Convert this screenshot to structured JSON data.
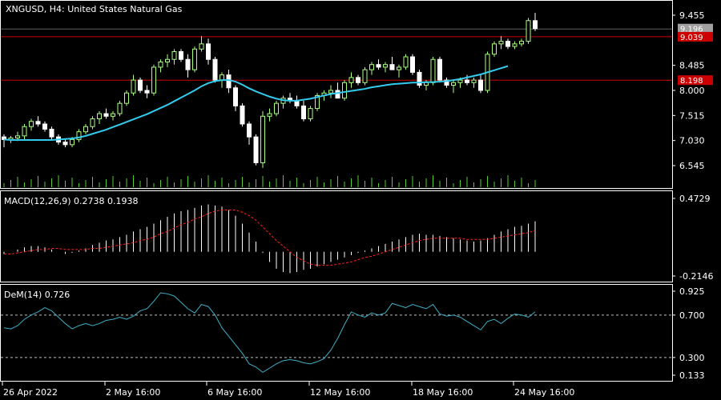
{
  "colors": {
    "background": "#000000",
    "frame": "#ffffff",
    "bull_candle": "#aaff7f",
    "bear_candle": "#ffffff",
    "volume": "#55cc33",
    "ma_line": "#33ccee",
    "hline": "#cc0000",
    "price_tag": "#a0a0a0",
    "macd_hist": "#ffffff",
    "macd_signal": "#ff2020",
    "dem_line": "#3fb0c8",
    "dem_level": "#c0c0c0"
  },
  "header": {
    "symbol_label": "XNGUSD, H4:  United States Natural Gas"
  },
  "x_axis": {
    "labels": [
      "26 Apr 2022",
      "2 May 16:00",
      "6 May 16:00",
      "12 May 16:00",
      "18 May 16:00",
      "24 May 16:00"
    ]
  },
  "chart_data": [
    {
      "type": "candlestick",
      "title": "XNGUSD, H4:  United States Natural Gas",
      "y_ticks": [
        "9.455",
        "8.485",
        "8.000",
        "7.515",
        "7.030",
        "6.545"
      ],
      "ylim": [
        6.2,
        9.55
      ],
      "price_tags": [
        {
          "text": "9.196",
          "value": 9.196,
          "kind": "current"
        },
        {
          "text": "9.039",
          "value": 9.039,
          "kind": "level"
        },
        {
          "text": "8.198",
          "value": 8.198,
          "kind": "level"
        }
      ],
      "horizontal_lines": [
        9.039,
        8.198
      ],
      "candles": [
        [
          7.1,
          7.15,
          6.9,
          7.05
        ],
        [
          7.05,
          7.12,
          6.98,
          7.08
        ],
        [
          7.08,
          7.2,
          7.02,
          7.12
        ],
        [
          7.12,
          7.35,
          7.05,
          7.3
        ],
        [
          7.3,
          7.45,
          7.22,
          7.4
        ],
        [
          7.4,
          7.5,
          7.3,
          7.35
        ],
        [
          7.35,
          7.4,
          7.2,
          7.25
        ],
        [
          7.25,
          7.3,
          7.05,
          7.1
        ],
        [
          7.1,
          7.15,
          6.95,
          7.0
        ],
        [
          7.0,
          7.05,
          6.9,
          6.95
        ],
        [
          6.95,
          7.1,
          6.9,
          7.05
        ],
        [
          7.05,
          7.25,
          7.0,
          7.2
        ],
        [
          7.2,
          7.35,
          7.15,
          7.3
        ],
        [
          7.3,
          7.5,
          7.25,
          7.45
        ],
        [
          7.45,
          7.6,
          7.35,
          7.55
        ],
        [
          7.55,
          7.65,
          7.45,
          7.5
        ],
        [
          7.5,
          7.6,
          7.42,
          7.55
        ],
        [
          7.55,
          7.8,
          7.5,
          7.75
        ],
        [
          7.75,
          8.0,
          7.7,
          7.95
        ],
        [
          7.95,
          8.3,
          7.9,
          8.2
        ],
        [
          8.2,
          8.25,
          7.95,
          8.0
        ],
        [
          8.0,
          8.1,
          7.85,
          7.95
        ],
        [
          7.95,
          8.5,
          7.9,
          8.45
        ],
        [
          8.45,
          8.6,
          8.35,
          8.55
        ],
        [
          8.55,
          8.7,
          8.45,
          8.6
        ],
        [
          8.6,
          8.8,
          8.5,
          8.75
        ],
        [
          8.75,
          8.8,
          8.55,
          8.6
        ],
        [
          8.6,
          8.7,
          8.25,
          8.4
        ],
        [
          8.4,
          8.85,
          8.35,
          8.8
        ],
        [
          8.8,
          9.05,
          8.75,
          8.9
        ],
        [
          8.9,
          9.0,
          8.5,
          8.6
        ],
        [
          8.6,
          8.65,
          8.15,
          8.2
        ],
        [
          8.2,
          8.35,
          8.05,
          8.3
        ],
        [
          8.3,
          8.4,
          7.95,
          8.05
        ],
        [
          8.05,
          8.1,
          7.6,
          7.7
        ],
        [
          7.7,
          7.75,
          7.3,
          7.35
        ],
        [
          7.35,
          7.4,
          6.95,
          7.1
        ],
        [
          7.1,
          7.15,
          6.55,
          6.6
        ],
        [
          6.6,
          7.6,
          6.5,
          7.5
        ],
        [
          7.5,
          7.65,
          7.4,
          7.55
        ],
        [
          7.55,
          7.8,
          7.5,
          7.75
        ],
        [
          7.75,
          7.9,
          7.65,
          7.85
        ],
        [
          7.85,
          7.95,
          7.75,
          7.8
        ],
        [
          7.8,
          7.9,
          7.65,
          7.7
        ],
        [
          7.7,
          7.8,
          7.4,
          7.45
        ],
        [
          7.45,
          7.7,
          7.4,
          7.65
        ],
        [
          7.65,
          7.95,
          7.6,
          7.9
        ],
        [
          7.9,
          8.0,
          7.8,
          7.95
        ],
        [
          7.95,
          8.1,
          7.85,
          8.0
        ],
        [
          8.0,
          8.15,
          7.9,
          7.85
        ],
        [
          7.85,
          8.2,
          7.8,
          8.15
        ],
        [
          8.15,
          8.35,
          8.05,
          8.25
        ],
        [
          8.25,
          8.3,
          8.1,
          8.15
        ],
        [
          8.15,
          8.45,
          8.1,
          8.4
        ],
        [
          8.4,
          8.55,
          8.3,
          8.5
        ],
        [
          8.5,
          8.6,
          8.4,
          8.45
        ],
        [
          8.45,
          8.55,
          8.35,
          8.5
        ],
        [
          8.5,
          8.65,
          8.45,
          8.4
        ],
        [
          8.4,
          8.5,
          8.25,
          8.45
        ],
        [
          8.45,
          8.7,
          8.4,
          8.65
        ],
        [
          8.65,
          8.7,
          8.3,
          8.35
        ],
        [
          8.35,
          8.4,
          8.05,
          8.1
        ],
        [
          8.1,
          8.2,
          8.0,
          8.15
        ],
        [
          8.15,
          8.65,
          8.1,
          8.6
        ],
        [
          8.6,
          8.65,
          8.15,
          8.2
        ],
        [
          8.2,
          8.25,
          8.05,
          8.1
        ],
        [
          8.1,
          8.2,
          7.95,
          8.15
        ],
        [
          8.15,
          8.25,
          8.05,
          8.2
        ],
        [
          8.2,
          8.3,
          8.1,
          8.15
        ],
        [
          8.15,
          8.25,
          8.05,
          8.2
        ],
        [
          8.2,
          8.3,
          7.95,
          8.0
        ],
        [
          8.0,
          8.75,
          7.95,
          8.7
        ],
        [
          8.7,
          8.95,
          8.65,
          8.9
        ],
        [
          8.9,
          9.05,
          8.8,
          8.95
        ],
        [
          8.95,
          9.0,
          8.8,
          8.85
        ],
        [
          8.85,
          8.95,
          8.8,
          8.9
        ],
        [
          8.9,
          9.0,
          8.85,
          8.95
        ],
        [
          8.95,
          9.4,
          8.9,
          9.35
        ],
        [
          9.35,
          9.5,
          9.15,
          9.196
        ]
      ],
      "ma_line": [
        7.05,
        7.04,
        7.04,
        7.04,
        7.04,
        7.04,
        7.04,
        7.04,
        7.05,
        7.06,
        7.07,
        7.09,
        7.12,
        7.16,
        7.2,
        7.24,
        7.29,
        7.34,
        7.39,
        7.44,
        7.49,
        7.54,
        7.6,
        7.66,
        7.72,
        7.79,
        7.86,
        7.93,
        8.0,
        8.08,
        8.14,
        8.18,
        8.2,
        8.2,
        8.17,
        8.11,
        8.04,
        7.98,
        7.93,
        7.88,
        7.84,
        7.81,
        7.8,
        7.8,
        7.82,
        7.84,
        7.87,
        7.9,
        7.93,
        7.95,
        7.97,
        7.99,
        8.01,
        8.03,
        8.06,
        8.08,
        8.1,
        8.12,
        8.13,
        8.14,
        8.15,
        8.15,
        8.16,
        8.16,
        8.17,
        8.18,
        8.2,
        8.22,
        8.25,
        8.28,
        8.31,
        8.35,
        8.39,
        8.43,
        8.47
      ]
    },
    {
      "type": "bar",
      "title": "MACD(12,26,9) 0.2738 0.1938",
      "label": "MACD(12,26,9)",
      "macd_value": "0.2738",
      "signal_value": "0.1938",
      "y_ticks": [
        "0.4729",
        "-0.2146"
      ],
      "ylim": [
        -0.2146,
        0.4729
      ],
      "series": [
        {
          "name": "MACD",
          "type": "bar",
          "values": [
            -0.02,
            0.0,
            0.02,
            0.04,
            0.05,
            0.05,
            0.04,
            0.02,
            0.0,
            -0.02,
            -0.01,
            0.01,
            0.03,
            0.06,
            0.08,
            0.1,
            0.11,
            0.13,
            0.15,
            0.18,
            0.2,
            0.22,
            0.25,
            0.28,
            0.31,
            0.34,
            0.36,
            0.37,
            0.39,
            0.41,
            0.42,
            0.41,
            0.4,
            0.37,
            0.32,
            0.25,
            0.17,
            0.09,
            -0.01,
            -0.09,
            -0.15,
            -0.18,
            -0.19,
            -0.18,
            -0.16,
            -0.15,
            -0.13,
            -0.11,
            -0.09,
            -0.07,
            -0.05,
            -0.03,
            -0.01,
            0.01,
            0.03,
            0.05,
            0.07,
            0.09,
            0.11,
            0.13,
            0.15,
            0.16,
            0.15,
            0.15,
            0.14,
            0.13,
            0.12,
            0.11,
            0.1,
            0.09,
            0.1,
            0.12,
            0.15,
            0.18,
            0.2,
            0.22,
            0.23,
            0.25,
            0.27
          ]
        },
        {
          "name": "Signal",
          "type": "line",
          "values": [
            -0.02,
            -0.02,
            -0.01,
            0.0,
            0.01,
            0.02,
            0.02,
            0.03,
            0.03,
            0.02,
            0.02,
            0.02,
            0.02,
            0.03,
            0.03,
            0.04,
            0.05,
            0.06,
            0.07,
            0.08,
            0.1,
            0.11,
            0.13,
            0.16,
            0.18,
            0.21,
            0.24,
            0.26,
            0.29,
            0.31,
            0.34,
            0.36,
            0.37,
            0.37,
            0.37,
            0.35,
            0.32,
            0.28,
            0.22,
            0.16,
            0.1,
            0.05,
            0.0,
            -0.05,
            -0.08,
            -0.11,
            -0.12,
            -0.12,
            -0.12,
            -0.11,
            -0.1,
            -0.09,
            -0.07,
            -0.05,
            -0.04,
            -0.02,
            0.0,
            0.02,
            0.04,
            0.06,
            0.08,
            0.1,
            0.11,
            0.12,
            0.12,
            0.12,
            0.12,
            0.12,
            0.11,
            0.11,
            0.11,
            0.11,
            0.12,
            0.13,
            0.14,
            0.15,
            0.16,
            0.17,
            0.19
          ]
        }
      ]
    },
    {
      "type": "line",
      "title": "DeM(14) 0.726",
      "label": "DeM(14)",
      "value": "0.726",
      "y_ticks": [
        "0.925",
        "0.700",
        "0.300",
        "0.133"
      ],
      "levels": [
        0.7,
        0.3
      ],
      "ylim": [
        0.133,
        0.925
      ],
      "series": [
        {
          "name": "DeM(14)",
          "values": [
            0.58,
            0.57,
            0.6,
            0.66,
            0.7,
            0.73,
            0.77,
            0.74,
            0.68,
            0.62,
            0.57,
            0.6,
            0.62,
            0.6,
            0.62,
            0.65,
            0.66,
            0.68,
            0.66,
            0.69,
            0.74,
            0.76,
            0.83,
            0.91,
            0.9,
            0.88,
            0.82,
            0.76,
            0.72,
            0.8,
            0.78,
            0.7,
            0.58,
            0.5,
            0.42,
            0.34,
            0.24,
            0.21,
            0.16,
            0.2,
            0.24,
            0.27,
            0.28,
            0.27,
            0.25,
            0.24,
            0.26,
            0.29,
            0.37,
            0.48,
            0.61,
            0.73,
            0.7,
            0.68,
            0.72,
            0.7,
            0.72,
            0.81,
            0.79,
            0.77,
            0.8,
            0.78,
            0.76,
            0.8,
            0.71,
            0.69,
            0.7,
            0.68,
            0.64,
            0.6,
            0.56,
            0.64,
            0.66,
            0.62,
            0.67,
            0.71,
            0.7,
            0.68,
            0.73
          ]
        }
      ]
    }
  ]
}
